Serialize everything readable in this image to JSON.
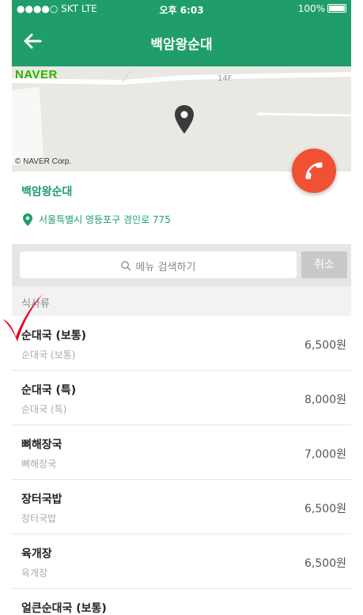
{
  "status": {
    "carrier": "●●●●○ SKT  LTE",
    "time": "오후 6:03",
    "battery": "100%"
  },
  "nav": {
    "title": "백암왕순대"
  },
  "map": {
    "brand": "NAVER",
    "floor": "14F",
    "copyright": "© NAVER Corp."
  },
  "restaurant": {
    "name": "백암왕순대",
    "address": "서울특별시 영등포구 경인로 775"
  },
  "search": {
    "placeholder": "메뉴 검색하기",
    "cancel": "취소"
  },
  "category": "식사류",
  "menu": [
    {
      "name": "순대국 (보통)",
      "sub": "순대국 (보통)",
      "price": "6,500원"
    },
    {
      "name": "순대국 (특)",
      "sub": "순대국 (특)",
      "price": "8,000원"
    },
    {
      "name": "뼈해장국",
      "sub": "뼈해장국",
      "price": "7,000원"
    },
    {
      "name": "장터국밥",
      "sub": "장터국밥",
      "price": "6,500원"
    },
    {
      "name": "육개장",
      "sub": "육개장",
      "price": "6,500원"
    },
    {
      "name": "얼큰순대국 (보통)",
      "sub": "",
      "price": ""
    }
  ],
  "colors": {
    "brand": "#1f9e6a",
    "call": "#f05133",
    "check": "#e8001c"
  }
}
